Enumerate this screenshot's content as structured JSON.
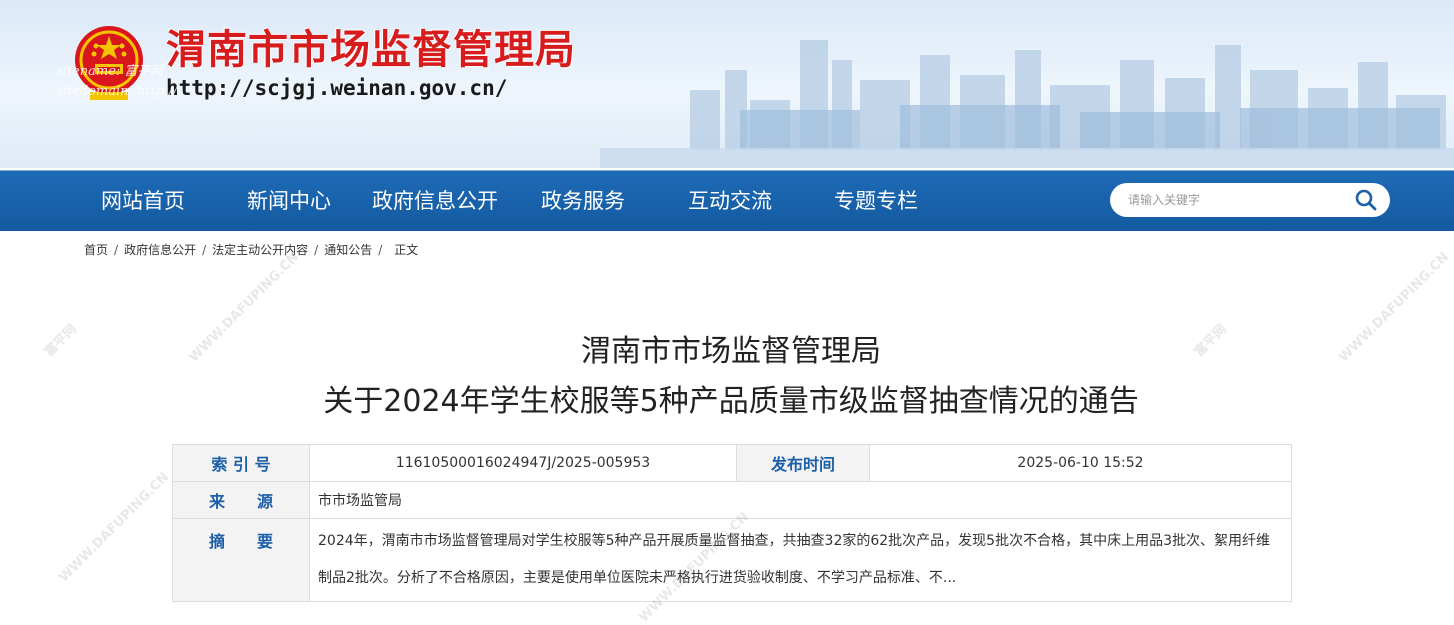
{
  "header": {
    "site_title": "渭南市市场监督管理局",
    "site_url": "http://scjgj.weinan.gov.cn/",
    "overlay_name": "sitename: 富平网",
    "overlay_domain": "sitedomain: http://"
  },
  "nav": {
    "items": [
      {
        "label": "网站首页"
      },
      {
        "label": "新闻中心"
      },
      {
        "label": "政府信息公开"
      },
      {
        "label": "政务服务"
      },
      {
        "label": "互动交流"
      },
      {
        "label": "专题专栏"
      }
    ],
    "search_placeholder": "请输入关键字",
    "search_icon": "search-icon"
  },
  "breadcrumb": {
    "items": [
      "首页",
      "政府信息公开",
      "法定主动公开内容",
      "通知公告"
    ],
    "current": "正文",
    "separator": "/"
  },
  "article": {
    "title_line1": "渭南市市场监督管理局",
    "title_line2": "关于2024年学生校服等5种产品质量市级监督抽查情况的通告"
  },
  "info": {
    "index_label": "索 引 号",
    "index_value": "11610500016024947J/2025-005953",
    "publish_label": "发布时间",
    "publish_value": "2025-06-10 15:52",
    "source_label": "来　　源",
    "source_value": "市市场监管局",
    "abstract_label": "摘　　要",
    "abstract_value": "2024年，渭南市市场监督管理局对学生校服等5种产品开展质量监督抽查，共抽查32家的62批次产品，发现5批次不合格，其中床上用品3批次、絮用纤维制品2批次。分析了不合格原因，主要是使用单位医院未严格执行进货验收制度、不学习产品标准、不..."
  },
  "watermark": {
    "brand": "富平网",
    "domain": "WWW.DAFUPING.CN"
  }
}
